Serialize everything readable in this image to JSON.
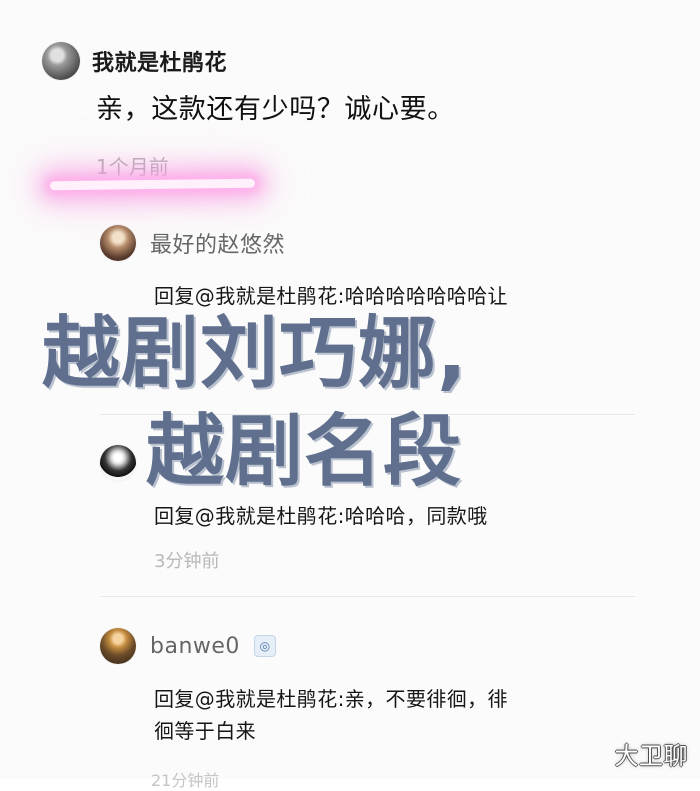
{
  "page": {
    "top_fragment": "",
    "watermark": "大卫聊",
    "overlay_title_line1": "越剧刘巧娜,",
    "overlay_title_line2": "越剧名段"
  },
  "main_comment": {
    "author": "我就是杜鹃花",
    "content": "亲，这款还有少吗？诚心要。",
    "time": "1个月前"
  },
  "replies": [
    {
      "author": "最好的赵悠然",
      "content": "回复@我就是杜鹃花:哈哈哈哈哈哈哈让",
      "time": ""
    },
    {
      "author": "",
      "content": "回复@我就是杜鹃花:哈哈哈，同款哦",
      "time": "3分钟前"
    },
    {
      "author": "banwe0",
      "badge": "◎",
      "content_line1": "回复@我就是杜鹃花:亲，不要徘徊，徘",
      "content_line2": "徊等于白来",
      "time": "21分钟前"
    }
  ]
}
